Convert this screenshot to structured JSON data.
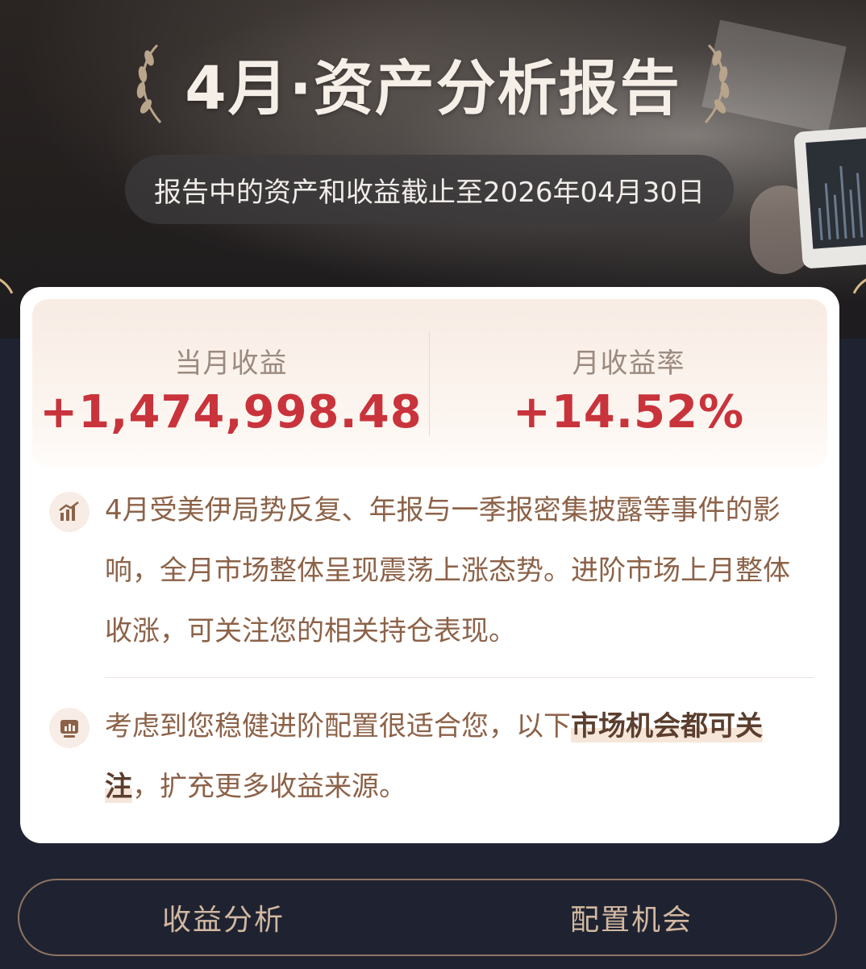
{
  "header": {
    "title": "4月·资产分析报告",
    "date_note": "报告中的资产和收益截止至2026年04月30日"
  },
  "stats": {
    "monthly_income_label": "当月收益",
    "monthly_income_value": "+1,474,998.48",
    "monthly_return_label": "月收益率",
    "monthly_return_value": "+14.52%"
  },
  "insights": {
    "market_summary": "4月受美伊局势反复、年报与一季报密集披露等事件的影响，全月市场整体呈现震荡上涨态势。进阶市场上月整体收涨，可关注您的相关持仓表现。",
    "advice_prefix": "考虑到您稳健进阶配置很适合您，以下",
    "advice_highlight": "市场机会都可关注",
    "advice_suffix": "，扩充更多收益来源。"
  },
  "tabs": [
    {
      "label": "收益分析"
    },
    {
      "label": "配置机会"
    }
  ],
  "colors": {
    "accent_red": "#c9333b",
    "brown_text": "#8c6248",
    "gold": "#d8b98a",
    "background": "#1f2331"
  },
  "icons": {
    "title_left": "laurel-left-icon",
    "title_right": "laurel-right-icon",
    "insight_1": "bar-chart-icon",
    "insight_2": "presentation-board-icon"
  }
}
